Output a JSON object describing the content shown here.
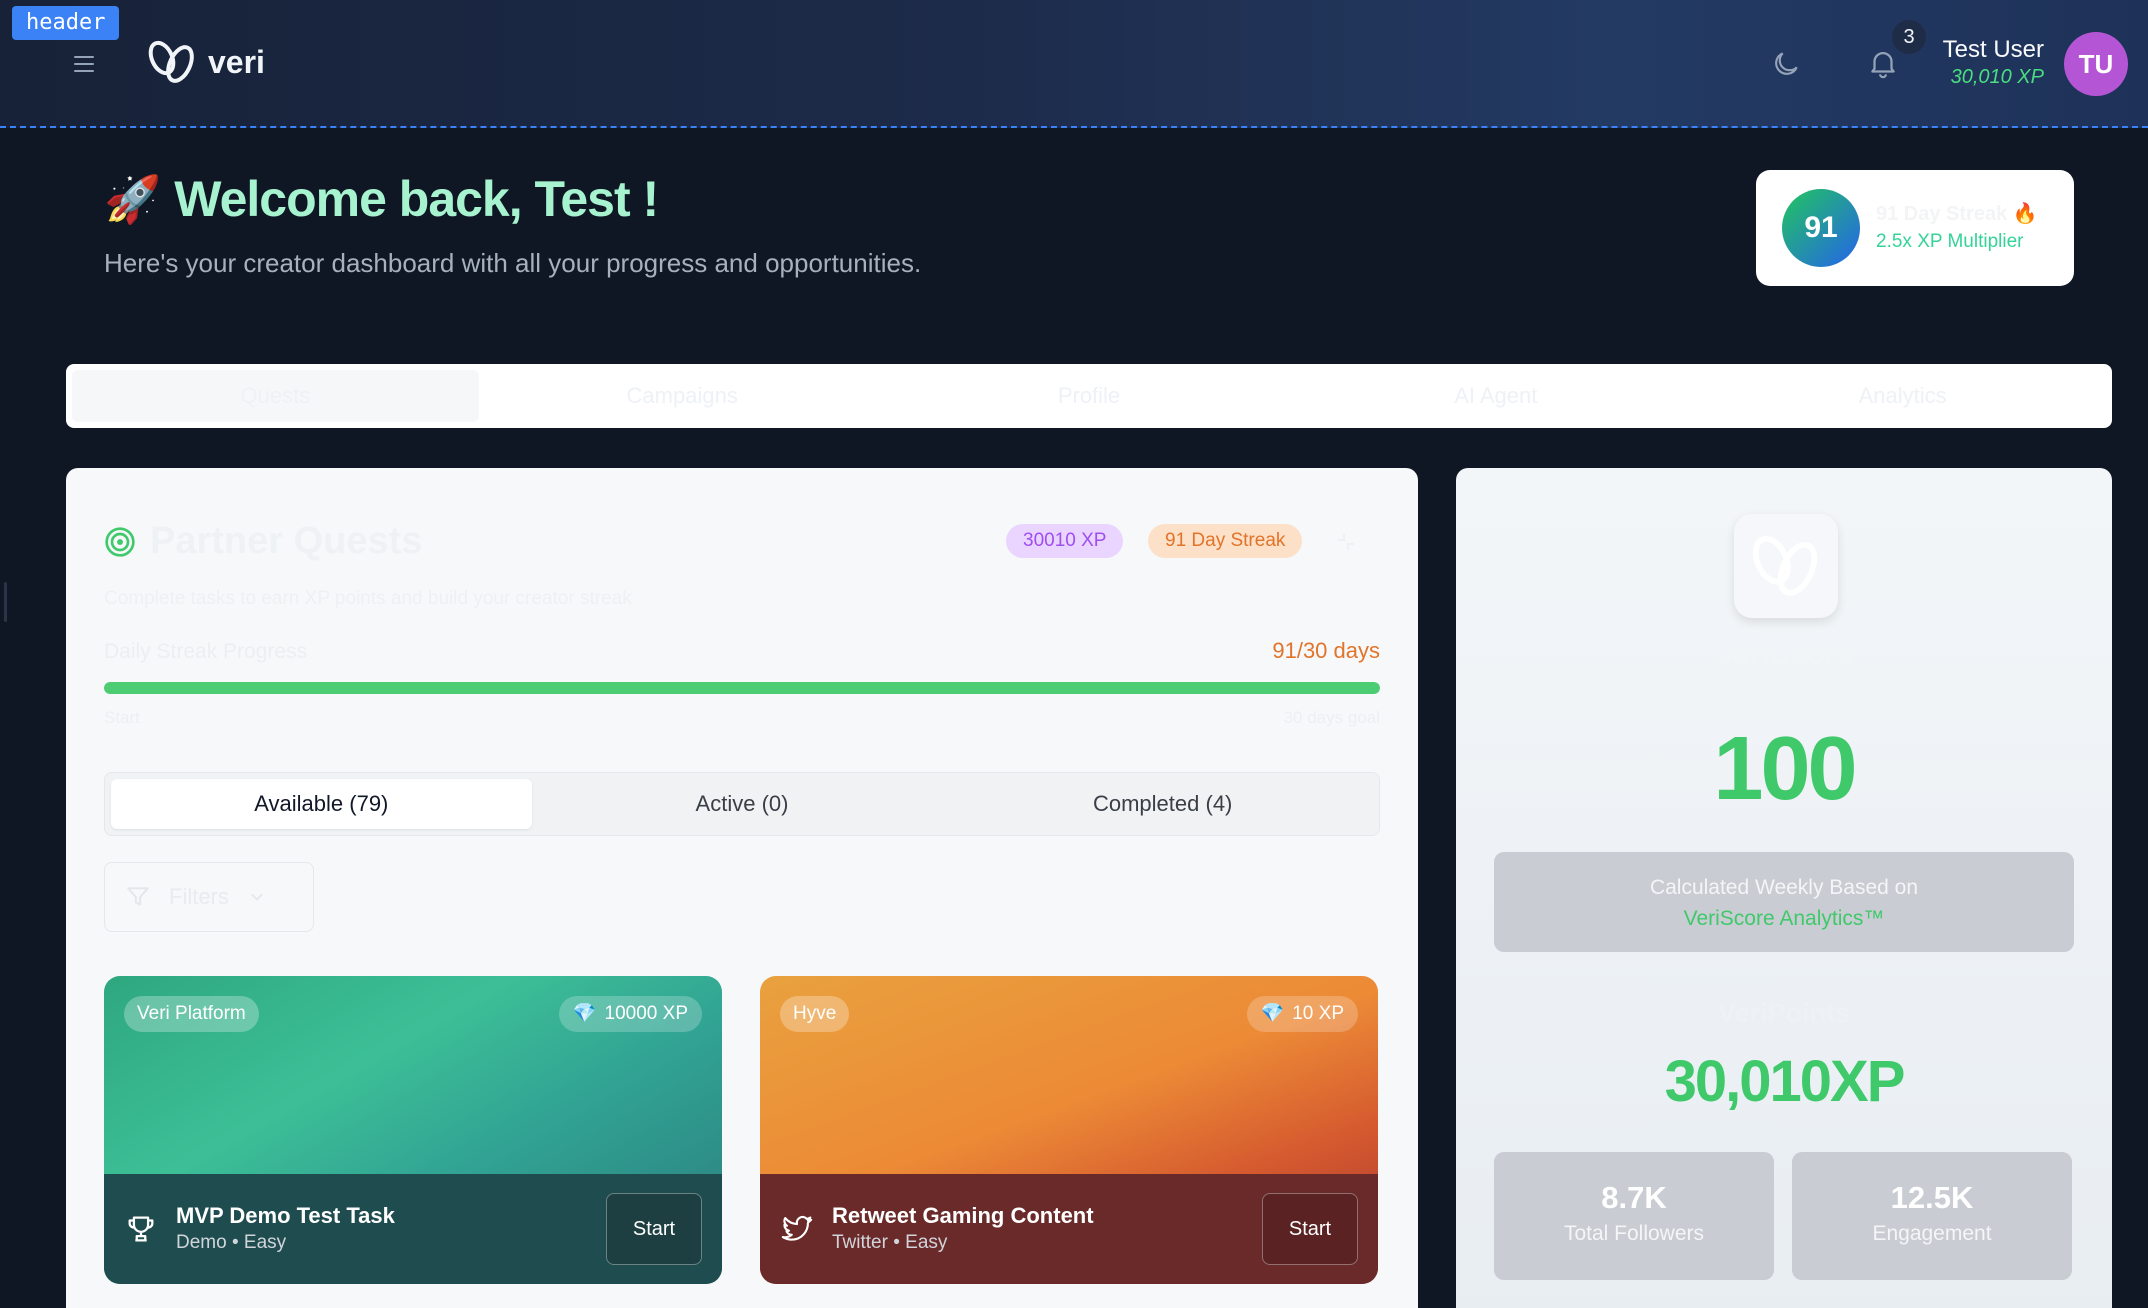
{
  "header": {
    "tag": "header",
    "app_name": "veri",
    "notification_count": "3",
    "user_name": "Test User",
    "user_xp": "30,010 XP",
    "avatar_initials": "TU"
  },
  "welcome": {
    "title": "Welcome back, Test !",
    "subtitle": "Here's your creator dashboard with all your progress and opportunities."
  },
  "streak_card": {
    "days": "91",
    "label": "91 Day Streak",
    "multiplier": "2.5x XP Multiplier"
  },
  "main_tabs": [
    {
      "label": "Quests",
      "active": true
    },
    {
      "label": "Campaigns"
    },
    {
      "label": "Profile"
    },
    {
      "label": "AI Agent"
    },
    {
      "label": "Analytics"
    }
  ],
  "partner_quests": {
    "title": "Partner Quests",
    "xp_badge": "30010 XP",
    "streak_badge": "91 Day Streak",
    "description": "Complete tasks to earn XP points and build your creator streak",
    "progress_label": "Daily Streak Progress",
    "progress_value": "91/30 days",
    "progress_fraction": 1.0,
    "progress_start": "Start",
    "progress_end": "30 days goal",
    "sub_tabs": [
      {
        "label": "Available (79)",
        "active": true
      },
      {
        "label": "Active (0)"
      },
      {
        "label": "Completed (4)"
      }
    ],
    "filters_label": "Filters",
    "quests": [
      {
        "partner": "Veri Platform",
        "xp": "10000 XP",
        "title": "MVP Demo Test Task",
        "meta": "Demo • Easy",
        "action": "Start"
      },
      {
        "partner": "Hyve",
        "xp": "10 XP",
        "title": "Retweet Gaming Content",
        "meta": "Twitter • Easy",
        "action": "Start"
      }
    ]
  },
  "veriscore": {
    "title": "VeriScore",
    "score": "100",
    "calc_line1": "Calculated Weekly Based on",
    "calc_line2": "VeriScore Analytics™",
    "points_title": "VeriPoints",
    "points_value": "30,010XP",
    "stats": [
      {
        "value": "8.7K",
        "label": "Total Followers"
      },
      {
        "value": "12.5K",
        "label": "Engagement"
      }
    ]
  },
  "colors": {
    "accent_green": "#3fc96a",
    "streak_orange": "#e2742a",
    "xp_purple": "#9f4ef0",
    "header_dashed": "#3b82f6"
  }
}
